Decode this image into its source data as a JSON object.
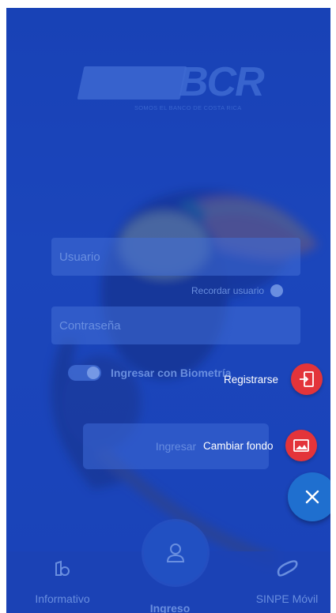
{
  "logo": {
    "text": "BCR",
    "tagline": "SOMOS EL BANCO DE COSTA RICA"
  },
  "form": {
    "user_placeholder": "Usuario",
    "remember_label": "Recordar usuario",
    "password_placeholder": "Contraseña",
    "biometric_label": "Ingresar con Biometría",
    "login_button": "Ingresar"
  },
  "fab_menu": {
    "register_label": "Registrarse",
    "change_background_label": "Cambiar fondo",
    "close_icon": "close-icon"
  },
  "bottom_nav": {
    "items": [
      {
        "label": "Informativo",
        "icon": "info-icon"
      },
      {
        "label": "Ingreso",
        "icon": "user-icon"
      },
      {
        "label": "SINPE Móvil",
        "icon": "sinpe-icon"
      }
    ]
  },
  "colors": {
    "overlay_blue": "#1a47b8",
    "fab_red": "#e3343a",
    "fab_close_blue": "#1f6fcf"
  }
}
